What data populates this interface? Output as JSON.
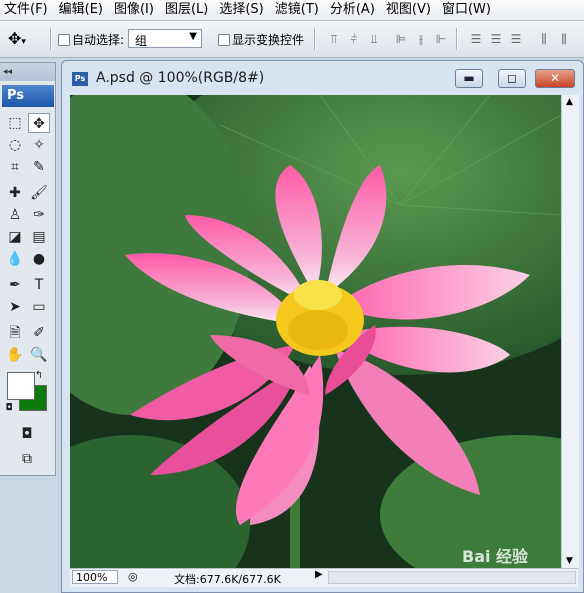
{
  "menu": [
    "文件(F)",
    "编辑(E)",
    "图像(I)",
    "图层(L)",
    "选择(S)",
    "滤镜(T)",
    "分析(A)",
    "视图(V)",
    "窗口(W)"
  ],
  "options": {
    "auto_select_label": "自动选择:",
    "auto_select_value": "组",
    "show_transform_label": "显示变换控件"
  },
  "toolbox": {
    "logo": "Ps"
  },
  "document": {
    "title": "A.psd @ 100%(RGB/8#)",
    "icon_text": "Ps"
  },
  "status": {
    "zoom": "100%",
    "doc_size": "文档:677.6K/677.6K"
  },
  "colors": {
    "foreground": "#ffffff",
    "background": "#0a7a0a"
  },
  "watermark": "Bai 经验"
}
